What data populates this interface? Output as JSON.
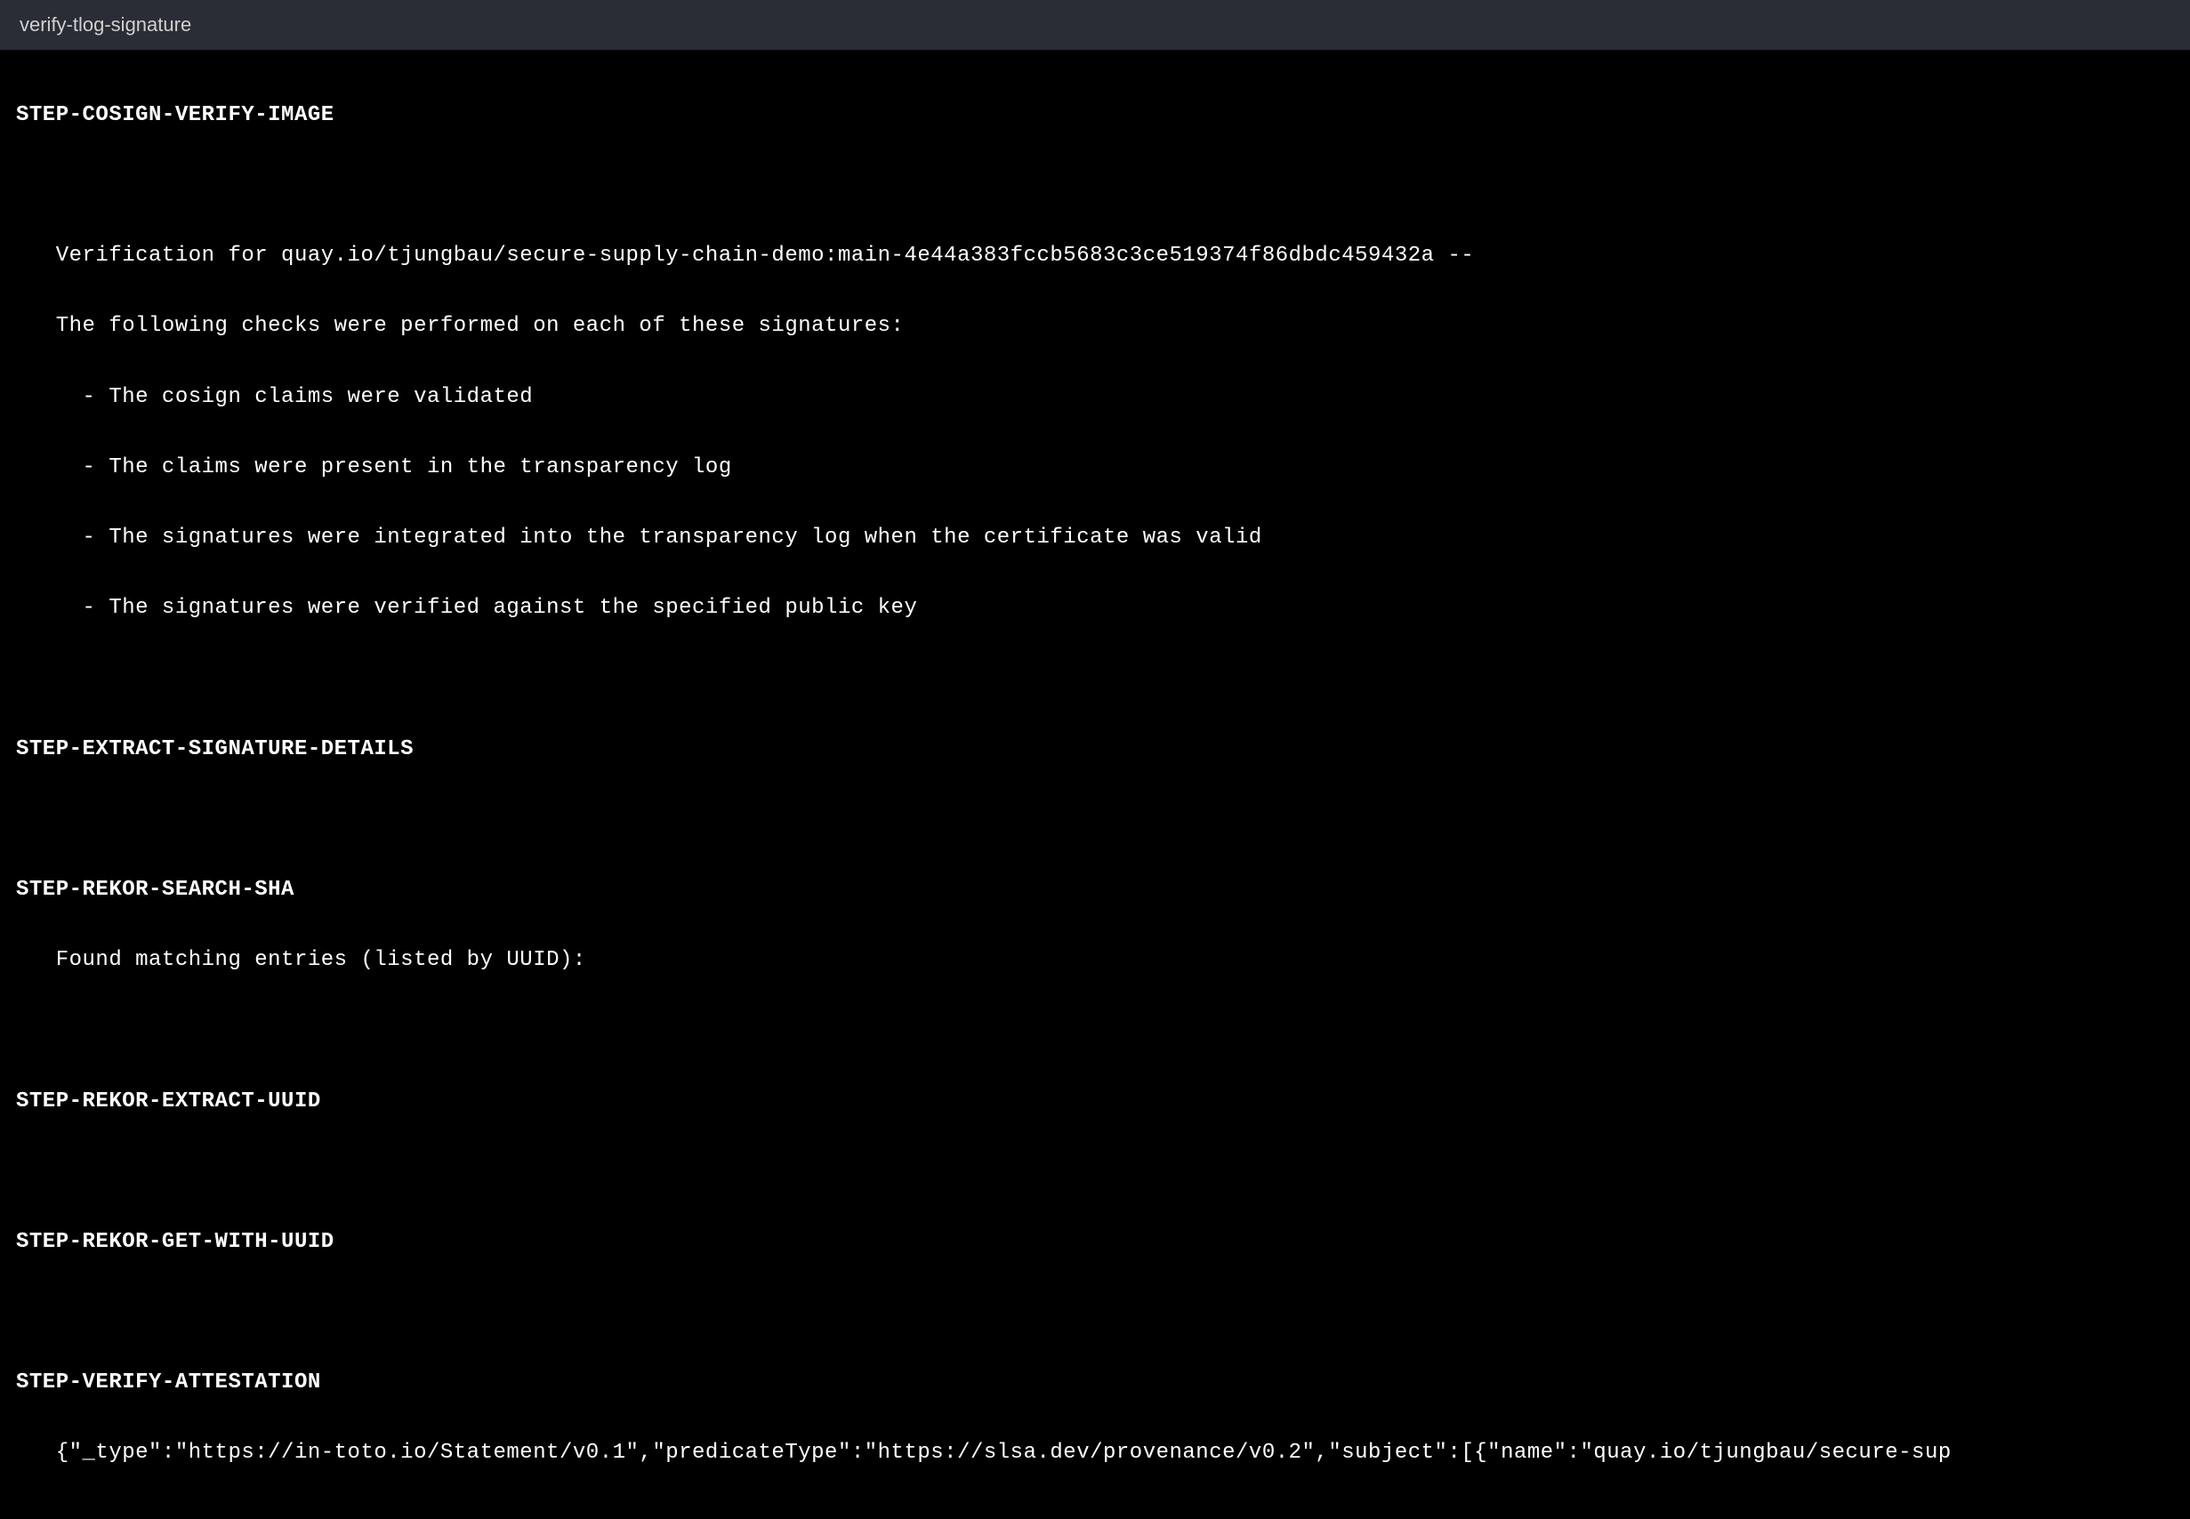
{
  "tab": {
    "title": "verify-tlog-signature"
  },
  "steps": {
    "cosign_verify_image": {
      "header": "STEP-COSIGN-VERIFY-IMAGE",
      "lines": [
        "   Verification for quay.io/tjungbau/secure-supply-chain-demo:main-4e44a383fccb5683c3ce519374f86dbdc459432a --",
        "   The following checks were performed on each of these signatures:",
        "     - The cosign claims were validated",
        "     - The claims were present in the transparency log",
        "     - The signatures were integrated into the transparency log when the certificate was valid",
        "     - The signatures were verified against the specified public key"
      ]
    },
    "extract_signature_details": {
      "header": "STEP-EXTRACT-SIGNATURE-DETAILS"
    },
    "rekor_search_sha": {
      "header": "STEP-REKOR-SEARCH-SHA",
      "line0": "   Found matching entries (listed by UUID):"
    },
    "rekor_extract_uuid": {
      "header": "STEP-REKOR-EXTRACT-UUID"
    },
    "rekor_get_with_uuid": {
      "header": "STEP-REKOR-GET-WITH-UUID"
    },
    "verify_attestation": {
      "header": "STEP-VERIFY-ATTESTATION",
      "line0": "   {\"_type\":\"https://in-toto.io/Statement/v0.1\",\"predicateType\":\"https://slsa.dev/provenance/v0.2\",\"subject\":[{\"name\":\"quay.io/tjungbau/secure-sup"
    }
  }
}
